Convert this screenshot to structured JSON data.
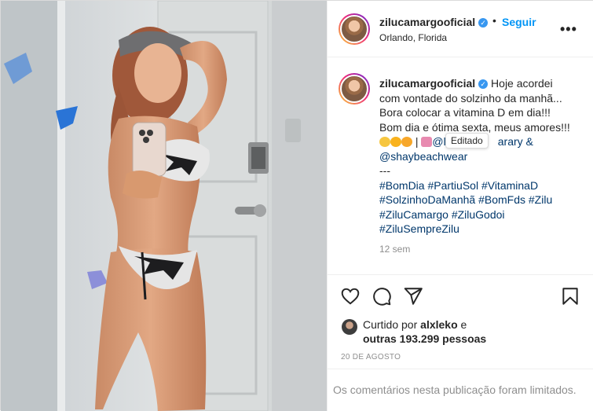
{
  "post": {
    "username": "zilucamargooficial",
    "verified_mark": "✓",
    "separator": "•",
    "follow_label": "Seguir",
    "location": "Orlando, Florida",
    "more_label": "•••"
  },
  "caption": {
    "username": "zilucamargooficial",
    "text_lines": [
      "Hoje acordei",
      "com vontade do solzinho da manhã...",
      "Bora colocar a vitamina D em dia!!!",
      "Bom dia e ótima sexta, meus amores!!!"
    ],
    "emoji_line_mention_tail": "@l",
    "emoji_line_mention_end": "arary &",
    "mention2": "@shaybeachwear",
    "separator": "---",
    "hashtags": [
      "#BomDia #PartiuSol #VitaminaD",
      "#SolzinhoDaManhã #BomFds #Zilu",
      "#ZiluCamargo #ZiluGodoi",
      "#ZiluSempreZilu"
    ],
    "tooltip": "Editado",
    "time_ago": "12 sem"
  },
  "actions": {
    "icons": [
      "heart-icon",
      "comment-icon",
      "share-icon",
      "bookmark-icon"
    ]
  },
  "likes": {
    "liked_by_prefix": "Curtido por",
    "liked_by_user": "alxleko",
    "liked_by_suffix": "e",
    "others": "outras 193.299 pessoas"
  },
  "date": "20 DE AGOSTO",
  "comments_limited": "Os comentários nesta publicação foram limitados.",
  "colors": {
    "accent": "#0095f6",
    "hashtag": "#00376b",
    "muted": "#8e8e8e",
    "verified": "#3897f0"
  }
}
